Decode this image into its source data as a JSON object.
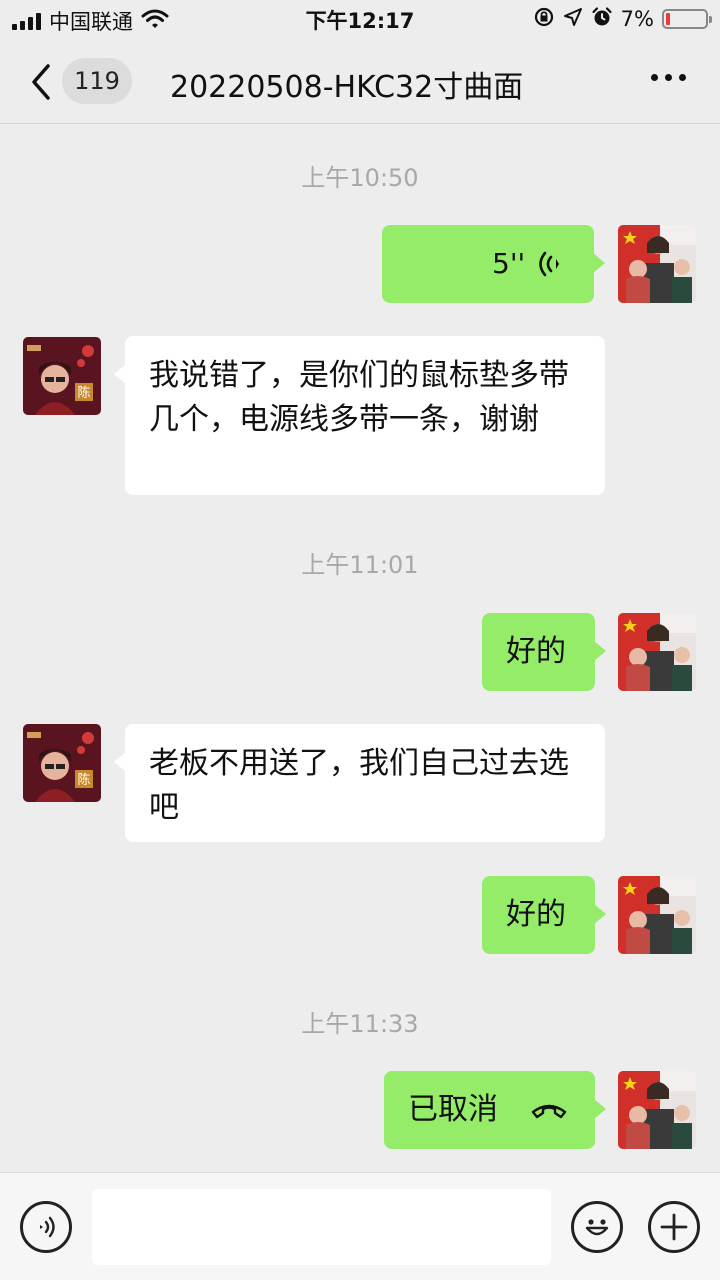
{
  "status_bar": {
    "carrier": "中国联通",
    "time": "下午12:17",
    "battery": "7%",
    "battery_level": 0.07,
    "icons": [
      "signal-icon",
      "wifi-icon",
      "rotation-lock-icon",
      "location-icon",
      "alarm-icon",
      "battery-icon"
    ]
  },
  "header": {
    "back_icon": "chevron-left-icon",
    "unread_count": "119",
    "title": "20220508-HKC32寸曲面",
    "more_icon": "more-dots-icon"
  },
  "messages": [
    {
      "type": "time",
      "text": "上午10:50"
    },
    {
      "type": "voice",
      "from": "me",
      "duration": "5''"
    },
    {
      "type": "text",
      "from": "other",
      "text": "我说错了，是你们的鼠标垫多带几个，电源线多带一条，谢谢"
    },
    {
      "type": "time",
      "text": "上午11:01"
    },
    {
      "type": "text",
      "from": "me",
      "text": "好的"
    },
    {
      "type": "text",
      "from": "other",
      "text": "老板不用送了，我们自己过去选吧"
    },
    {
      "type": "text",
      "from": "me",
      "text": "好的"
    },
    {
      "type": "time",
      "text": "上午11:33"
    },
    {
      "type": "call",
      "from": "me",
      "text": "已取消"
    }
  ],
  "contact_avatar": {
    "name_char": "陈"
  },
  "input_bar": {
    "voice_icon": "voice-input-icon",
    "emoji_icon": "emoji-icon",
    "plus_icon": "plus-icon",
    "value": ""
  },
  "colors": {
    "outgoing_bubble": "#95ec69",
    "incoming_bubble": "#ffffff",
    "background": "#ededed"
  }
}
